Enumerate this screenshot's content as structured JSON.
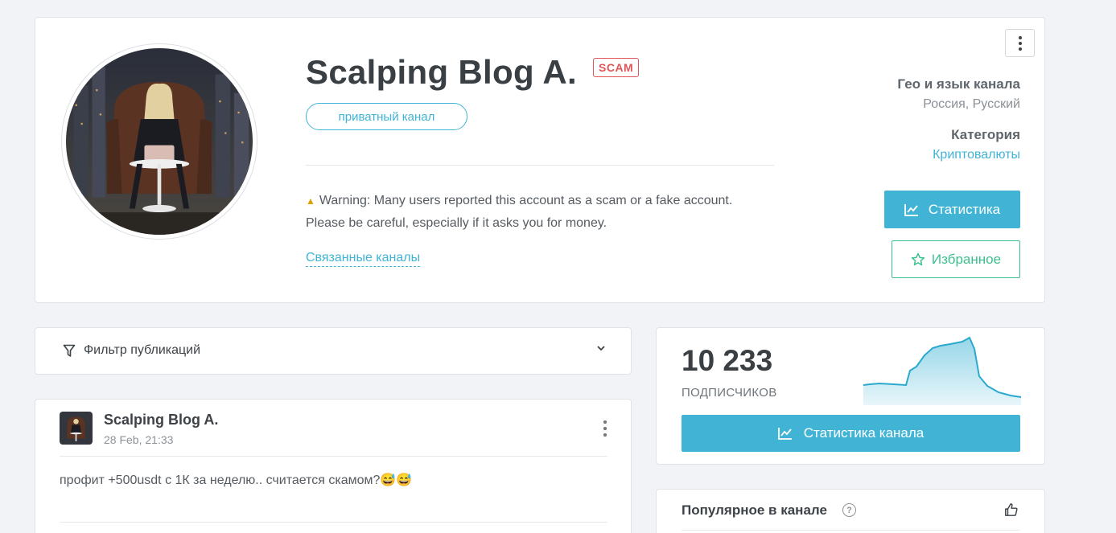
{
  "header": {
    "channel_name": "Scalping Blog A.",
    "scam_badge": "SCAM",
    "private_label": "приватный канал",
    "warning_text": "Warning: Many users reported this account as a scam or a fake account. Please be careful, especially if it asks you for money.",
    "related_channels": "Связанные каналы",
    "geo_label": "Гео и язык канала",
    "geo_value": "Россия, Русский",
    "category_label": "Категория",
    "category_value": "Криптовалюты",
    "stats_button": "Статистика",
    "favorites_button": "Избранное"
  },
  "filter": {
    "label": "Фильтр публикаций"
  },
  "post": {
    "author": "Scalping Blog A.",
    "date": "28 Feb, 21:33",
    "text": "профит +500usdt с 1К за неделю.. считается скамом?😅😅"
  },
  "subscribers": {
    "count": "10 233",
    "label": "ПОДПИСЧИКОВ",
    "button": "Статистика канала"
  },
  "popular": {
    "title": "Популярное в канале",
    "help": "?"
  },
  "colors": {
    "accent": "#41b4d6",
    "scam": "#e05555",
    "favorite": "#3cbf8f",
    "background": "#f2f3f6"
  }
}
